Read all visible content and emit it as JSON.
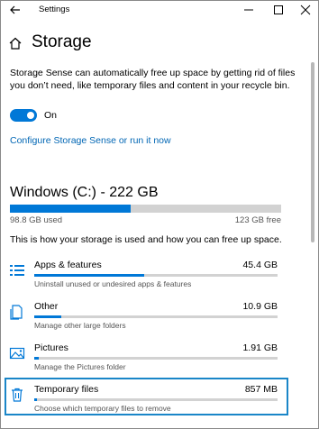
{
  "window": {
    "title": "Settings"
  },
  "page": {
    "title": "Storage"
  },
  "storage_sense": {
    "description": "Storage Sense can automatically free up space by getting rid of files you don’t need, like temporary files and content in your recycle bin.",
    "toggle_state": "On",
    "toggle_on": true,
    "configure_link": "Configure Storage Sense or run it now"
  },
  "drive": {
    "title": "Windows (C:) - 222 GB",
    "used_label": "98.8 GB used",
    "free_label": "123 GB free",
    "used_fraction": 0.445
  },
  "usage_intro": "This is how your storage is used and how you can free up space.",
  "categories": [
    {
      "name": "Apps & features",
      "size": "45.4 GB",
      "subtitle": "Uninstall unused or undesired apps & features",
      "icon": "apps-list-icon",
      "fraction": 0.45
    },
    {
      "name": "Other",
      "size": "10.9 GB",
      "subtitle": "Manage other large folders",
      "icon": "document-folder-icon",
      "fraction": 0.11
    },
    {
      "name": "Pictures",
      "size": "1.91 GB",
      "subtitle": "Manage the Pictures folder",
      "icon": "picture-icon",
      "fraction": 0.02
    },
    {
      "name": "Temporary files",
      "size": "857 MB",
      "subtitle": "Choose which temporary files to remove",
      "icon": "trash-icon",
      "fraction": 0.01
    }
  ],
  "colors": {
    "accent": "#0078d7",
    "link": "#0066b4",
    "bar_track": "#d2d2d2",
    "highlight": "#1a86c8"
  }
}
